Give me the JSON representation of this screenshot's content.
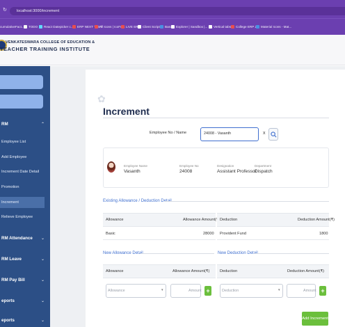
{
  "browser": {
    "url": "localhost:3000/increment",
    "bookmarks": [
      {
        "label": "cumulativeFact...",
        "color": "#f5f5f5"
      },
      {
        "label": "TODO",
        "color": "#f5f5f5"
      },
      {
        "label": "React Datepicker c...",
        "color": "#61dafb"
      },
      {
        "label": "ERP NEXT TEST",
        "color": "#e94e4e"
      },
      {
        "label": "All Icons | IcoFont",
        "color": "#e94e4e"
      },
      {
        "label": "LIVE ERP",
        "color": "#e94e4e"
      },
      {
        "label": "Client Script",
        "color": "#ffffff"
      },
      {
        "label": "Bard",
        "color": "#4a90e2"
      },
      {
        "label": "Explorer | Sandbox |...",
        "color": "#ffffff"
      },
      {
        "label": "Vertical tabs",
        "color": "#ffffff"
      },
      {
        "label": "College ERP 2.0",
        "color": "#e94e4e"
      },
      {
        "label": "Material Icons - Mat...",
        "color": "#4a90e2"
      }
    ]
  },
  "header": {
    "institute_line1": "VENKATESWARA COLLEGE OF EDUCATION &",
    "institute_line2": "TEACHER TRAINING INSTITUTE"
  },
  "sidebar": {
    "groups": [
      {
        "label": "RM"
      },
      {
        "label": "RM Attendance"
      },
      {
        "label": "RM Leave"
      },
      {
        "label": "RM Pay Bill"
      },
      {
        "label": "eports"
      },
      {
        "label": "eports"
      }
    ],
    "items": [
      {
        "label": "Employee List"
      },
      {
        "label": "Add Employee"
      },
      {
        "label": "Increment Date Detail"
      },
      {
        "label": "Promotion"
      },
      {
        "label": "Increment"
      },
      {
        "label": "Relieve Employee"
      }
    ]
  },
  "page": {
    "title": "Increment",
    "search_label": "Employee No / Name",
    "search_value": "24008 - Vasanth"
  },
  "employee": {
    "name_label": "Employee Name",
    "name": "Vasanth",
    "no_label": "Employee No",
    "no": "24008",
    "designation_label": "Designation",
    "designation": "Assistant Professor",
    "department_label": "Department",
    "department": "Dispatch"
  },
  "existing": {
    "title": "Existing Allowance / Deduction Detail",
    "allowance_header": "Allowance",
    "allowance_amount_header": "Allowance Amount(₹)",
    "deduction_header": "Deduction",
    "deduction_amount_header": "Deduction Amount(₹)",
    "allowances": [
      {
        "name": "Basic",
        "amount": "28000"
      }
    ],
    "deductions": [
      {
        "name": "Provident Fund",
        "amount": "1800"
      }
    ]
  },
  "new_allowance": {
    "title": "New Allowance Detail",
    "header": "Allowance",
    "amount_header": "Allowance Amount(₹)",
    "select_placeholder": "Allowance",
    "amount_placeholder": "Amount"
  },
  "new_deduction": {
    "title": "New Deduction Detail",
    "header": "Deduction",
    "amount_header": "Deduction Amount(₹)",
    "select_placeholder": "Deduction",
    "amount_placeholder": "Amount"
  },
  "actions": {
    "add_increment": "Add Increment",
    "plus": "+",
    "clear": "x"
  },
  "colors": {
    "browser_chrome": "#6b3fb0",
    "sidebar": "#2c4f86",
    "accent": "#3f6fcf",
    "success": "#6bbf3c"
  }
}
